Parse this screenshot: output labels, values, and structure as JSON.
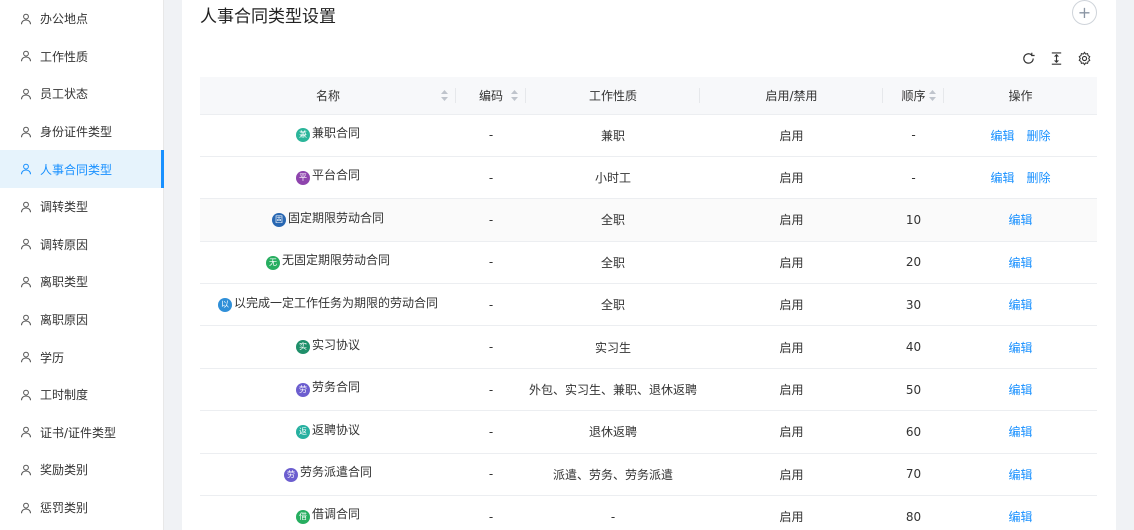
{
  "sidebar": {
    "items": [
      {
        "label": "办公地点",
        "active": false
      },
      {
        "label": "工作性质",
        "active": false
      },
      {
        "label": "员工状态",
        "active": false
      },
      {
        "label": "身份证件类型",
        "active": false
      },
      {
        "label": "人事合同类型",
        "active": true
      },
      {
        "label": "调转类型",
        "active": false
      },
      {
        "label": "调转原因",
        "active": false
      },
      {
        "label": "离职类型",
        "active": false
      },
      {
        "label": "离职原因",
        "active": false
      },
      {
        "label": "学历",
        "active": false
      },
      {
        "label": "工时制度",
        "active": false
      },
      {
        "label": "证书/证件类型",
        "active": false
      },
      {
        "label": "奖励类别",
        "active": false
      },
      {
        "label": "惩罚类别",
        "active": false
      }
    ]
  },
  "main": {
    "title": "人事合同类型设置",
    "add_symbol": "+"
  },
  "table": {
    "columns": [
      {
        "label": "名称",
        "sortable": true
      },
      {
        "label": "编码",
        "sortable": true
      },
      {
        "label": "工作性质",
        "sortable": false
      },
      {
        "label": "启用/禁用",
        "sortable": false
      },
      {
        "label": "顺序",
        "sortable": true
      },
      {
        "label": "操作",
        "sortable": false
      }
    ],
    "rows": [
      {
        "badge": "兼",
        "badge_color": "#2bb59a",
        "name": "兼职合同",
        "code": "-",
        "nature": "兼职",
        "status": "启用",
        "order": "-",
        "actions": [
          "编辑",
          "删除"
        ]
      },
      {
        "badge": "平",
        "badge_color": "#8e44ad",
        "name": "平台合同",
        "code": "-",
        "nature": "小时工",
        "status": "启用",
        "order": "-",
        "actions": [
          "编辑",
          "删除"
        ]
      },
      {
        "badge": "固",
        "badge_color": "#2867b2",
        "name": "固定期限劳动合同",
        "code": "-",
        "nature": "全职",
        "status": "启用",
        "order": "10",
        "actions": [
          "编辑"
        ]
      },
      {
        "badge": "无",
        "badge_color": "#27ae60",
        "name": "无固定期限劳动合同",
        "code": "-",
        "nature": "全职",
        "status": "启用",
        "order": "20",
        "actions": [
          "编辑"
        ]
      },
      {
        "badge": "以",
        "badge_color": "#2f8fd8",
        "name": "以完成一定工作任务为期限的劳动合同",
        "code": "-",
        "nature": "全职",
        "status": "启用",
        "order": "30",
        "actions": [
          "编辑"
        ]
      },
      {
        "badge": "实",
        "badge_color": "#1f8f6a",
        "name": "实习协议",
        "code": "-",
        "nature": "实习生",
        "status": "启用",
        "order": "40",
        "actions": [
          "编辑"
        ]
      },
      {
        "badge": "劳",
        "badge_color": "#6c5ecf",
        "name": "劳务合同",
        "code": "-",
        "nature": "外包、实习生、兼职、退休返聘",
        "status": "启用",
        "order": "50",
        "actions": [
          "编辑"
        ]
      },
      {
        "badge": "返",
        "badge_color": "#26b0a0",
        "name": "返聘协议",
        "code": "-",
        "nature": "退休返聘",
        "status": "启用",
        "order": "60",
        "actions": [
          "编辑"
        ]
      },
      {
        "badge": "劳",
        "badge_color": "#6c5ecf",
        "name": "劳务派遣合同",
        "code": "-",
        "nature": "派遣、劳务、劳务派遣",
        "status": "启用",
        "order": "70",
        "actions": [
          "编辑"
        ]
      },
      {
        "badge": "借",
        "badge_color": "#27ae60",
        "name": "借调合同",
        "code": "-",
        "nature": "-",
        "status": "启用",
        "order": "80",
        "actions": [
          "编辑"
        ]
      }
    ]
  },
  "icons": {
    "user": "user-icon",
    "refresh": "refresh-icon",
    "column_height": "column-height-icon",
    "settings": "gear-icon",
    "sort": "sort-icon"
  }
}
